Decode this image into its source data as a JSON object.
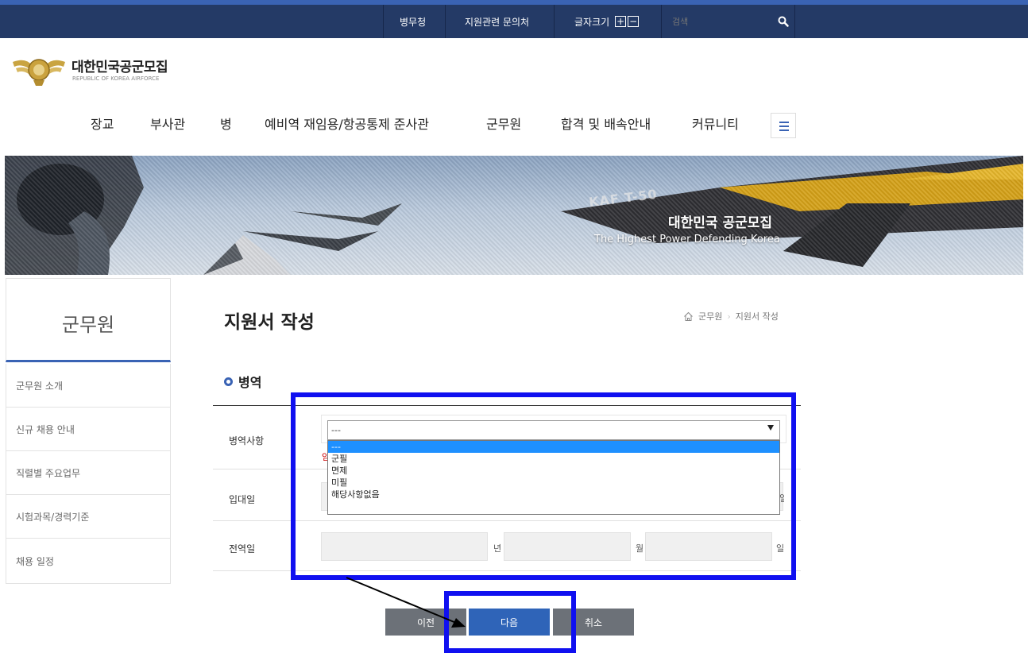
{
  "topbar": {
    "links": [
      "병무청",
      "지원관련 문의처"
    ],
    "font_size_label": "글자크기",
    "font_plus": "+",
    "font_minus": "−",
    "search_placeholder": "검색",
    "search_icon": "search-icon"
  },
  "logo": {
    "title": "대한민국공군모집",
    "subtitle": "REPUBLIC OF KOREA AIRFORCE"
  },
  "nav": {
    "items": [
      "장교",
      "부사관",
      "병",
      "예비역 재임용/항공통제 준사관",
      "군무원",
      "합격 및 배속안내",
      "커뮤니티"
    ],
    "menu_icon": "hamburger-icon"
  },
  "banner": {
    "title": "대한민국 공군모집",
    "subtitle": "The Highest Power Defending Korea",
    "jet_marking": "KAF T-50"
  },
  "sidebar": {
    "title": "군무원",
    "items": [
      "군무원 소개",
      "신규 채용 안내",
      "직렬별 주요업무",
      "시험과목/경력기준",
      "채용 일정"
    ]
  },
  "page": {
    "title": "지원서 작성",
    "breadcrumb": [
      "군무원",
      "지원서 작성"
    ]
  },
  "section": {
    "title": "병역"
  },
  "form": {
    "military_service": {
      "label": "병역사항",
      "selected": "---",
      "options": [
        "---",
        "군필",
        "면제",
        "미필",
        "해당사항없음"
      ],
      "highlighted_option": "---",
      "hint_fragment": "임"
    },
    "enlist_date": {
      "label": "입대일",
      "unit_day": "일"
    },
    "discharge_date": {
      "label": "전역일",
      "unit_year": "년",
      "unit_month": "월",
      "unit_day": "일"
    }
  },
  "buttons": {
    "prev": "이전",
    "next": "다음",
    "cancel": "취소"
  },
  "colors": {
    "topbar": "#243a66",
    "accent": "#3a63b4",
    "next_button": "#2f64b8",
    "gray_button": "#6c7178",
    "annotation": "#1010f0"
  }
}
